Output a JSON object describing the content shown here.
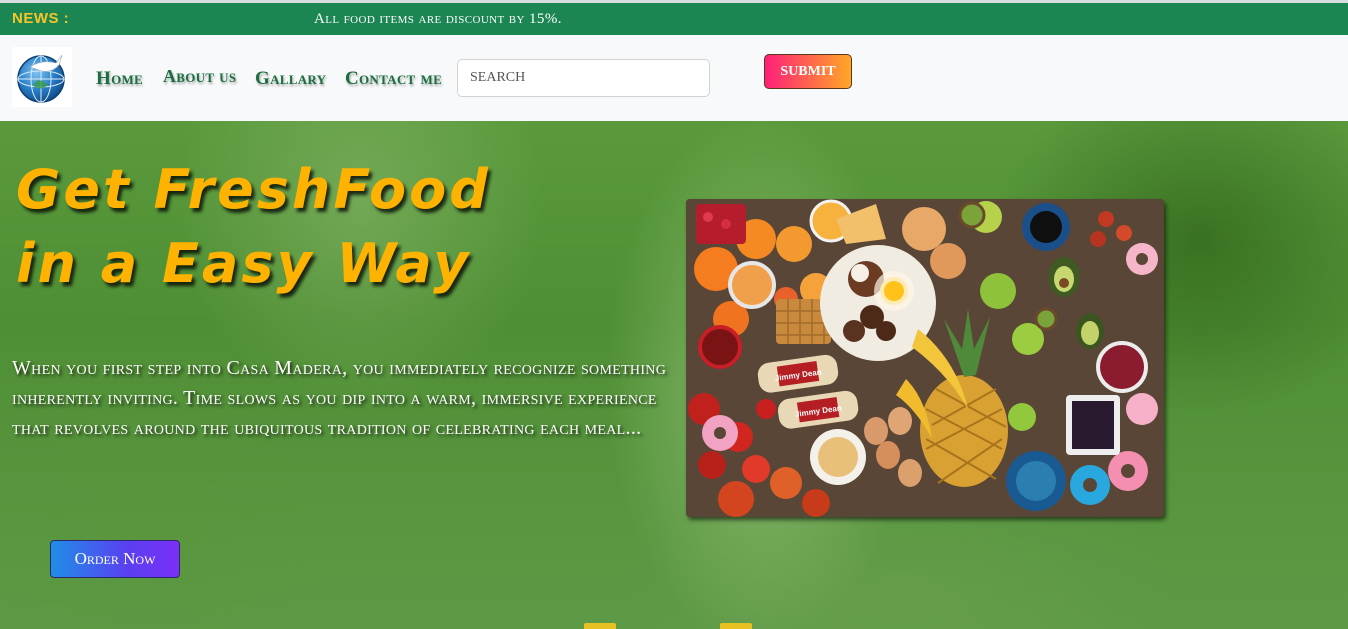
{
  "news": {
    "label": "NEWS :",
    "text": "All food items are discount by 15%."
  },
  "header": {
    "logo_icon": "globe-logo-icon",
    "nav": {
      "home": "Home",
      "about": "About us",
      "gallery": "Gallary",
      "contact": "Contact me"
    },
    "search": {
      "placeholder": "SEARCH",
      "value": ""
    },
    "submit_label": "SUBMIT"
  },
  "hero": {
    "headline_line1": "Get FreshFood",
    "headline_line2": "in a Easy Way",
    "paragraph": "When you first step into Casa Madera, you immediately recognize something inherently inviting. Time slows as you dip into a warm, immersive experience that revolves around the ubiquitous tradition of celebrating each meal...",
    "order_button": "Order Now",
    "image": "fresh-food-spread-image",
    "image_labels": [
      "Jimmy Dean",
      "Jimmy Dean"
    ]
  },
  "colors": {
    "news_bar": "#1b8652",
    "news_label": "#f7c52a",
    "nav_link": "#1b6e3f",
    "headline": "#ffb300",
    "submit_gradient": [
      "#ff1f7a",
      "#ffa726"
    ],
    "order_gradient": [
      "#1f8ee8",
      "#7b2ff7"
    ]
  }
}
